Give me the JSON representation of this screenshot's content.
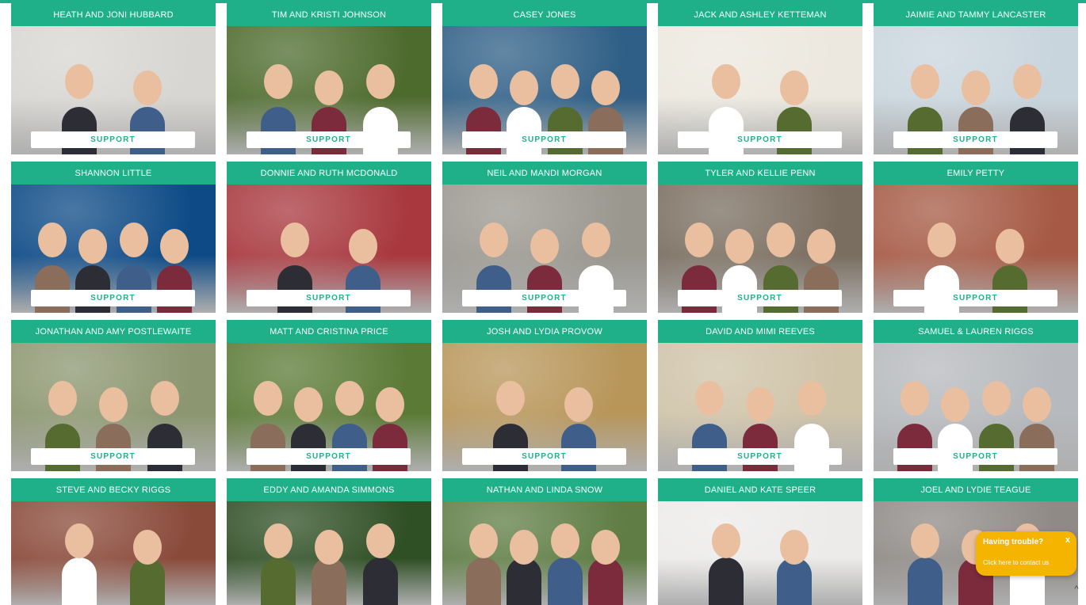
{
  "support_label": "SUPPORT",
  "missionaries": [
    {
      "name": "HEATH AND JONI HUBBARD",
      "photo_bg": "#d8d6d2"
    },
    {
      "name": "TIM AND KRISTI JOHNSON",
      "photo_bg": "#4e6b2e"
    },
    {
      "name": "CASEY JONES",
      "photo_bg": "#2f5f86"
    },
    {
      "name": "JACK AND ASHLEY KETTEMAN",
      "photo_bg": "#ece8df"
    },
    {
      "name": "JAIMIE AND TAMMY LANCASTER",
      "photo_bg": "#c9d5dd"
    },
    {
      "name": "SHANNON LITTLE",
      "photo_bg": "#0d4a86"
    },
    {
      "name": "DONNIE AND RUTH MCDONALD",
      "photo_bg": "#a8383e"
    },
    {
      "name": "NEIL AND MANDI MORGAN",
      "photo_bg": "#9a978f"
    },
    {
      "name": "TYLER AND KELLIE PENN",
      "photo_bg": "#7a6e60"
    },
    {
      "name": "EMILY PETTY",
      "photo_bg": "#a65a45"
    },
    {
      "name": "JONATHAN AND AMY POSTLEWAITE",
      "photo_bg": "#8c9670"
    },
    {
      "name": "MATT AND CRISTINA PRICE",
      "photo_bg": "#5b7a36"
    },
    {
      "name": "JOSH AND LYDIA PROVOW",
      "photo_bg": "#b8965a"
    },
    {
      "name": "DAVID AND MIMI REEVES",
      "photo_bg": "#cfc3a8"
    },
    {
      "name": "SAMUEL & LAUREN RIGGS",
      "photo_bg": "#b6b9bd"
    },
    {
      "name": "STEVE AND BECKY RIGGS",
      "photo_bg": "#8a4a3a"
    },
    {
      "name": "EDDY AND AMANDA SIMMONS",
      "photo_bg": "#2f4f25"
    },
    {
      "name": "NATHAN AND LINDA SNOW",
      "photo_bg": "#5f7d45"
    },
    {
      "name": "DANIEL AND KATE SPEER",
      "photo_bg": "#ecebea"
    },
    {
      "name": "JOEL AND LYDIE TEAGUE",
      "photo_bg": "#8f8a86"
    }
  ],
  "help_widget": {
    "title": "Having trouble?",
    "close": "x",
    "link": "Click here to contact us"
  },
  "colors": {
    "accent": "#1fb08a",
    "widget": "#f5b400"
  }
}
